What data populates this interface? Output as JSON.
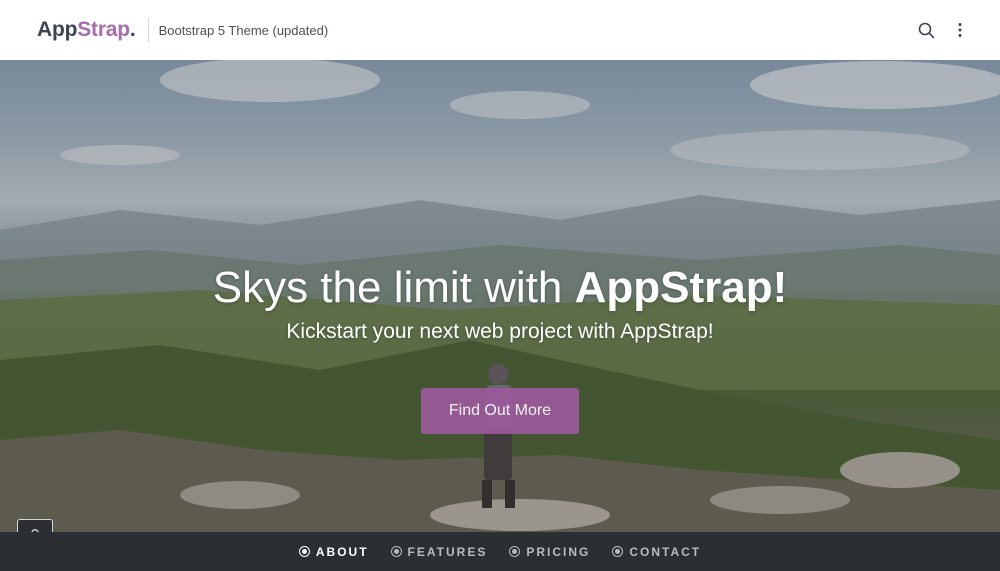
{
  "header": {
    "brand_app": "App",
    "brand_strap": "Strap",
    "brand_dot": ".",
    "tagline": "Bootstrap 5 Theme (updated)",
    "icons": [
      "search-icon",
      "more-vertical-icon"
    ]
  },
  "hero": {
    "title_plain": "Skys the limit with ",
    "title_bold": "AppStrap!",
    "subtitle": "Kickstart your next web project with AppStrap!",
    "cta_label": "Find Out More"
  },
  "nav": {
    "items": [
      {
        "label": "ABOUT",
        "active": true
      },
      {
        "label": "FEATURES",
        "active": false
      },
      {
        "label": "PRICING",
        "active": false
      },
      {
        "label": "CONTACT",
        "active": false
      }
    ]
  },
  "colors": {
    "brand_accent": "#a86bb0",
    "cta": "#9b5a9c",
    "nav_bg": "#2b2f33"
  }
}
